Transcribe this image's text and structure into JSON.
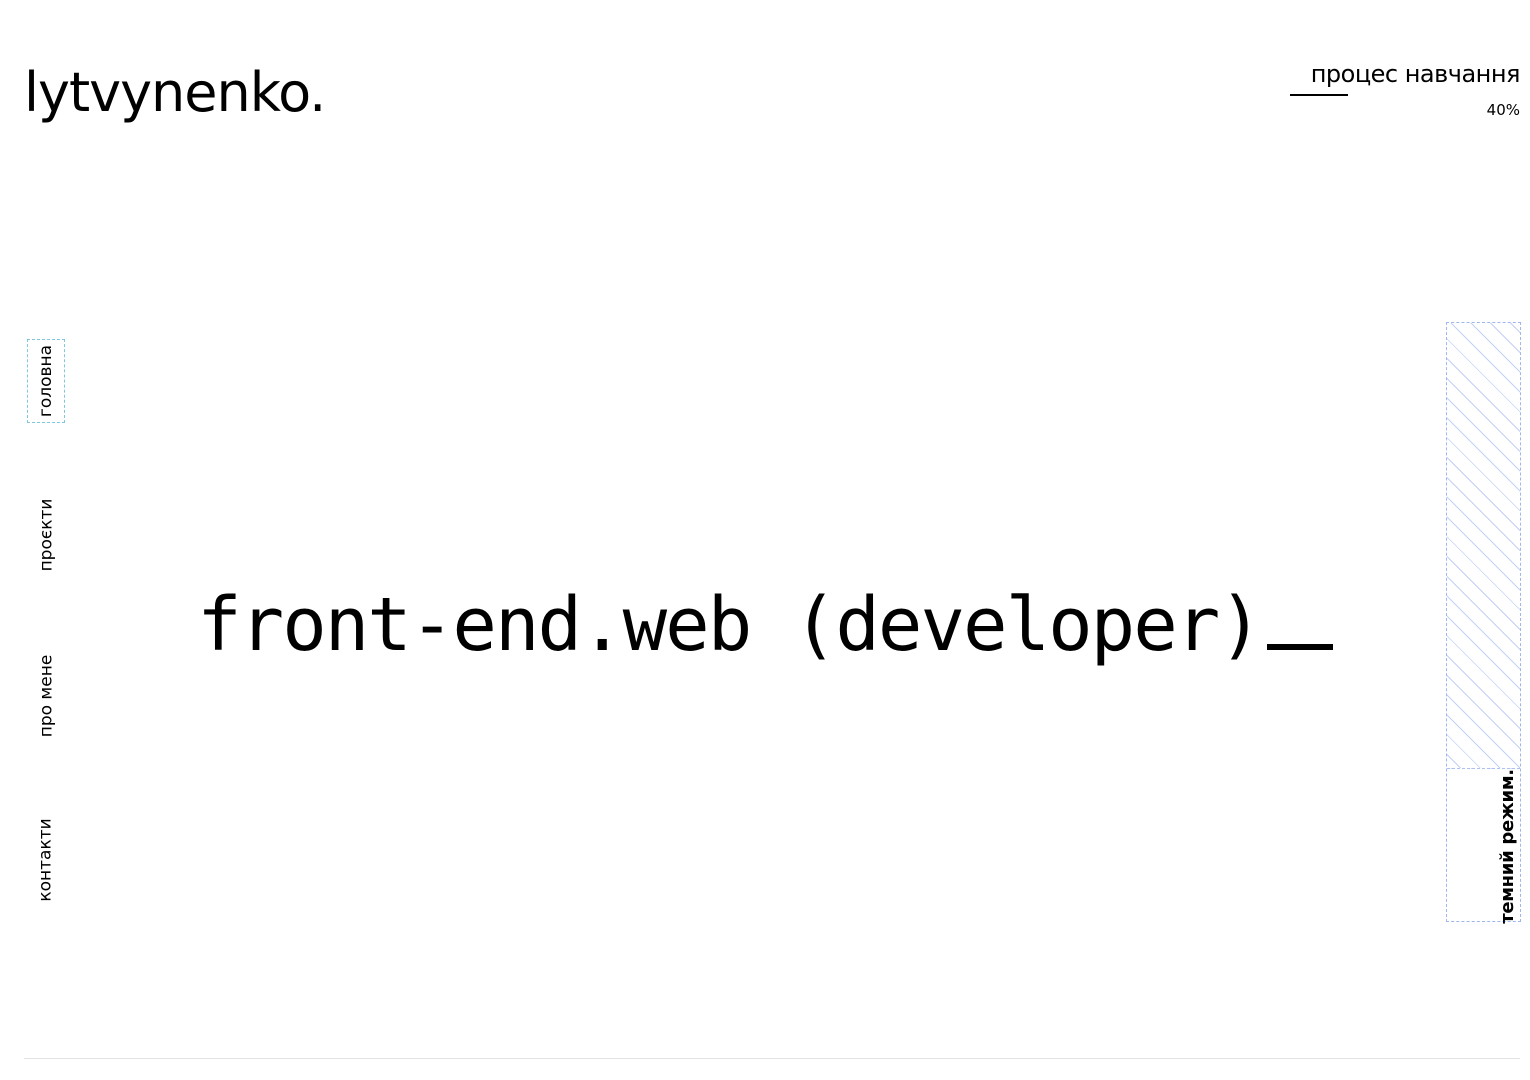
{
  "header": {
    "logo": "lytvynenko."
  },
  "progress": {
    "title": "процес навчання",
    "percent_label": "40%",
    "value": 0.25
  },
  "nav": {
    "items": [
      {
        "label": "головна",
        "active": true
      },
      {
        "label": "проєкти",
        "active": false
      },
      {
        "label": "про мене",
        "active": false
      },
      {
        "label": "контакти",
        "active": false
      }
    ]
  },
  "hero": {
    "text": "front-end.web (developer)"
  },
  "theme_toggle": {
    "label": "темний режим."
  },
  "colors": {
    "text": "#000000",
    "background": "#ffffff",
    "active_outline": "#7ec7dc",
    "toggle_dash": "#9fb6f0"
  }
}
